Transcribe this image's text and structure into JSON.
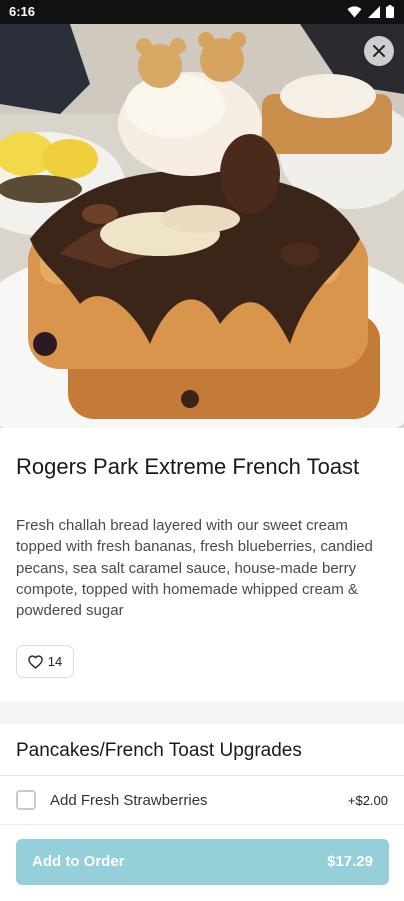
{
  "status_bar": {
    "time": "6:16",
    "icons": [
      "wifi-icon",
      "signal-icon",
      "battery-icon"
    ]
  },
  "header": {
    "close_icon": "close-icon"
  },
  "hero_image": {
    "subject": "french-toast-photo"
  },
  "item": {
    "title": "Rogers Park Extreme French Toast",
    "description": "Fresh challah bread layered with our sweet cream topped with fresh bananas, fresh blueberries, candied pecans, sea salt caramel sauce, house-made berry compote, topped with homemade whipped cream & powdered sugar",
    "likes": "14",
    "like_icon": "heart-icon"
  },
  "upgrades": {
    "title": "Pancakes/French Toast Upgrades",
    "options": [
      {
        "label": "Add Fresh Strawberries",
        "price": "+$2.00",
        "checked": false
      }
    ]
  },
  "footer": {
    "button_label": "Add to Order",
    "total": "$17.29",
    "button_color": "#95cfd9"
  }
}
